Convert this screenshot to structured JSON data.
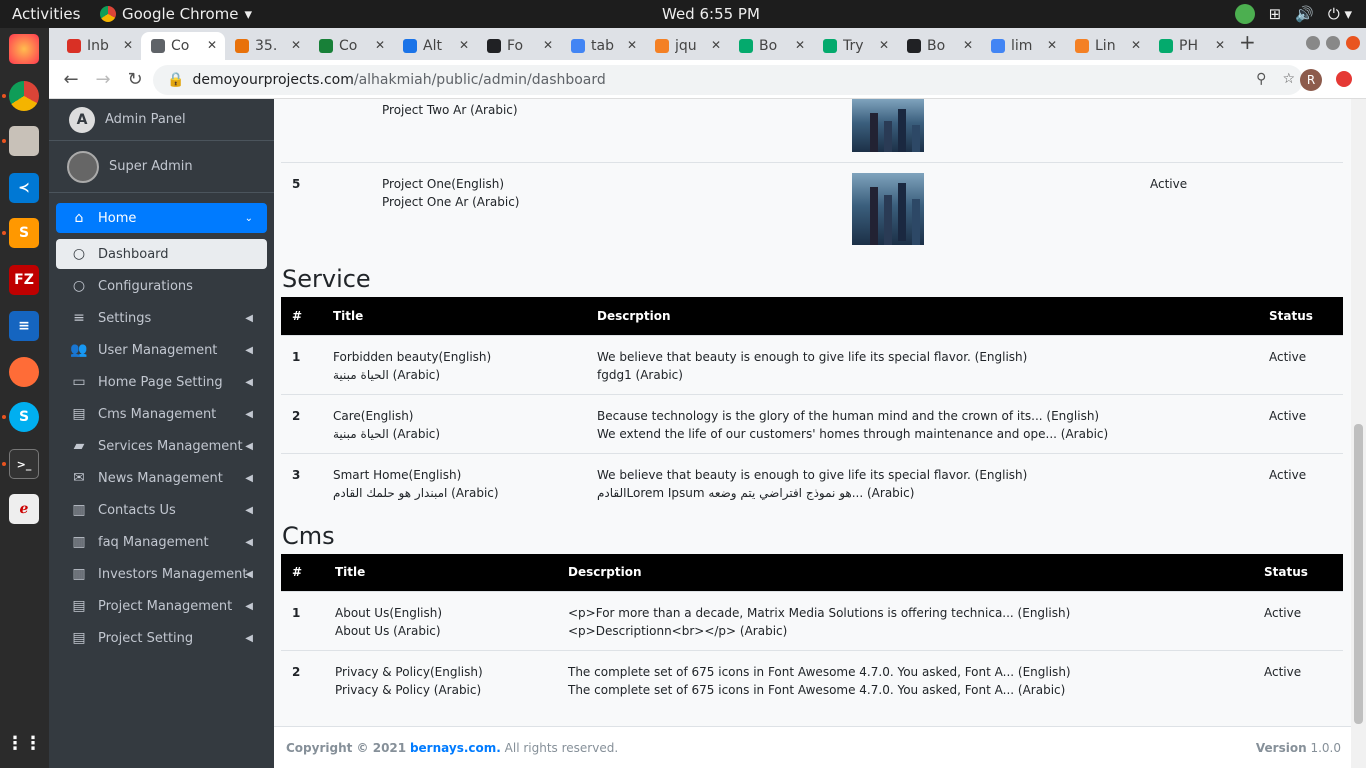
{
  "system": {
    "activities": "Activities",
    "app_name": "Google Chrome",
    "clock": "Wed  6:55 PM"
  },
  "browser": {
    "tabs": [
      {
        "label": "Inb",
        "color": "#d93025"
      },
      {
        "label": "Co",
        "color": "#5f6368"
      },
      {
        "label": "35.",
        "color": "#e8710a"
      },
      {
        "label": "Co",
        "color": "#188038"
      },
      {
        "label": "Alt",
        "color": "#1a73e8"
      },
      {
        "label": "Fo",
        "color": "#202124"
      },
      {
        "label": "tab",
        "color": "#4285f4"
      },
      {
        "label": "jqu",
        "color": "#f48024"
      },
      {
        "label": "Bo",
        "color": "#04aa6d"
      },
      {
        "label": "Try",
        "color": "#04aa6d"
      },
      {
        "label": "Bo",
        "color": "#202124"
      },
      {
        "label": "lim",
        "color": "#4285f4"
      },
      {
        "label": "Lin",
        "color": "#f48024"
      },
      {
        "label": "PH",
        "color": "#04aa6d"
      }
    ],
    "url_host": "demoyourprojects.com",
    "url_path": "/alhakmiah/public/admin/dashboard",
    "profile_initial": "R"
  },
  "sidebar": {
    "brand": "Admin Panel",
    "brand_logo": "A",
    "user": "Super Admin",
    "items": [
      {
        "label": "Home",
        "icon": "home-icon",
        "glyph": "⌂",
        "arrow": "⌄"
      },
      {
        "label": "Dashboard",
        "icon": "circle-icon",
        "glyph": "○",
        "arrow": ""
      },
      {
        "label": "Configurations",
        "icon": "circle-icon",
        "glyph": "○",
        "arrow": ""
      },
      {
        "label": "Settings",
        "icon": "bars-icon",
        "glyph": "≡",
        "arrow": "◀"
      },
      {
        "label": "User Management",
        "icon": "users-icon",
        "glyph": "👥",
        "arrow": "◀"
      },
      {
        "label": "Home Page Setting",
        "icon": "tv-icon",
        "glyph": "▭",
        "arrow": "◀"
      },
      {
        "label": "Cms Management",
        "icon": "file-icon",
        "glyph": "▤",
        "arrow": "◀"
      },
      {
        "label": "Services Management",
        "icon": "truck-icon",
        "glyph": "▰",
        "arrow": "◀"
      },
      {
        "label": "News Management",
        "icon": "envelope-icon",
        "glyph": "✉",
        "arrow": "◀"
      },
      {
        "label": "Contacts Us",
        "icon": "building-icon",
        "glyph": "▥",
        "arrow": "◀"
      },
      {
        "label": "faq Management",
        "icon": "building-icon",
        "glyph": "▥",
        "arrow": "◀"
      },
      {
        "label": "Investors Management",
        "icon": "building-icon",
        "glyph": "▥",
        "arrow": "◀"
      },
      {
        "label": "Project Management",
        "icon": "file-icon",
        "glyph": "▤",
        "arrow": "◀"
      },
      {
        "label": "Project Setting",
        "icon": "file-icon",
        "glyph": "▤",
        "arrow": "◀"
      }
    ]
  },
  "projects": {
    "rows": [
      {
        "num": "",
        "line1": "Project Two Ar (Arabic)",
        "line2": "",
        "status": ""
      },
      {
        "num": "5",
        "line1": "Project One(English)",
        "line2": "Project One Ar (Arabic)",
        "status": "Active"
      }
    ]
  },
  "service": {
    "heading": "Service",
    "headers": [
      "#",
      "Title",
      "Descrption",
      "Status"
    ],
    "rows": [
      {
        "num": "1",
        "t1": "Forbidden beauty(English)",
        "t2": "الحياة مبنية (Arabic)",
        "d1": "We believe that beauty is enough to give life its special flavor. (English)",
        "d2": "fgdg1 (Arabic)",
        "status": "Active"
      },
      {
        "num": "2",
        "t1": "Care(English)",
        "t2": "الحياة مبنية (Arabic)",
        "d1": "Because technology is the glory of the human mind and the crown of its... (English)",
        "d2": "We extend the life of our customers' homes through maintenance and ope... (Arabic)",
        "status": "Active"
      },
      {
        "num": "3",
        "t1": "Smart Home(English)",
        "t2": "امبندار هو حلمك القادم (Arabic)",
        "d1": "We believe that beauty is enough to give life its special flavor. (English)",
        "d2": "القادمLorem Ipsum هو نموذج افتراضي يتم وضعه... (Arabic)",
        "status": "Active"
      }
    ]
  },
  "cms": {
    "heading": "Cms",
    "headers": [
      "#",
      "Title",
      "Descrption",
      "Status"
    ],
    "rows": [
      {
        "num": "1",
        "t1": "About Us(English)",
        "t2": "About Us (Arabic)",
        "d1": "<p>For more than a decade, Matrix Media Solutions is offering technica... (English)",
        "d2": "<p>Descriptionn<br></p> (Arabic)",
        "status": "Active"
      },
      {
        "num": "2",
        "t1": "Privacy & Policy(English)",
        "t2": "Privacy & Policy (Arabic)",
        "d1": "The complete set of 675 icons in Font Awesome 4.7.0. You asked, Font A... (English)",
        "d2": "The complete set of 675 icons in Font Awesome 4.7.0. You asked, Font A... (Arabic)",
        "status": "Active"
      }
    ]
  },
  "footer": {
    "copyright": "Copyright © 2021",
    "brand": "bernays.com.",
    "rights": "All rights reserved.",
    "version_label": "Version",
    "version": "1.0.0"
  }
}
